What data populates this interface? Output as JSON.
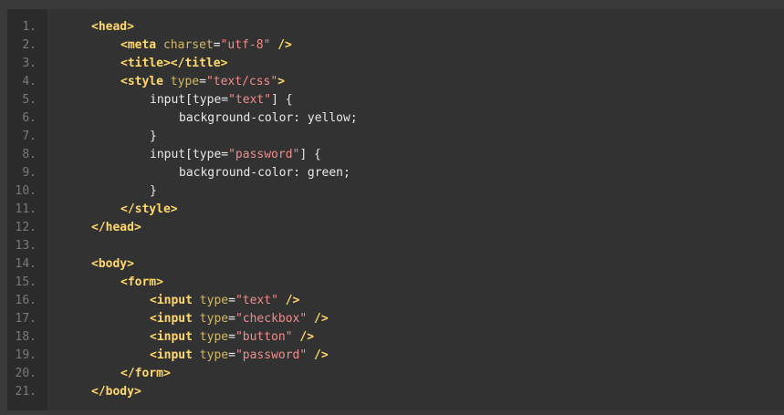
{
  "lines": [
    {
      "n": "1.",
      "indent": 1,
      "tokens": [
        {
          "c": "t",
          "v": "<head>"
        }
      ]
    },
    {
      "n": "2.",
      "indent": 2,
      "tokens": [
        {
          "c": "t",
          "v": "<meta "
        },
        {
          "c": "a",
          "v": "charset"
        },
        {
          "c": "p",
          "v": "="
        },
        {
          "c": "s",
          "v": "\"utf-8\""
        },
        {
          "c": "t",
          "v": " />"
        }
      ]
    },
    {
      "n": "3.",
      "indent": 2,
      "tokens": [
        {
          "c": "t",
          "v": "<title></title>"
        }
      ]
    },
    {
      "n": "4.",
      "indent": 2,
      "tokens": [
        {
          "c": "t",
          "v": "<style "
        },
        {
          "c": "a",
          "v": "type"
        },
        {
          "c": "p",
          "v": "="
        },
        {
          "c": "s",
          "v": "\"text/css\""
        },
        {
          "c": "t",
          "v": ">"
        }
      ]
    },
    {
      "n": "5.",
      "indent": 3,
      "tokens": [
        {
          "c": "p",
          "v": "input[type="
        },
        {
          "c": "s",
          "v": "\"text\""
        },
        {
          "c": "p",
          "v": "] {"
        }
      ]
    },
    {
      "n": "6.",
      "indent": 4,
      "tokens": [
        {
          "c": "p",
          "v": "background-color: yellow;"
        }
      ]
    },
    {
      "n": "7.",
      "indent": 3,
      "tokens": [
        {
          "c": "p",
          "v": "}"
        }
      ]
    },
    {
      "n": "8.",
      "indent": 3,
      "tokens": [
        {
          "c": "p",
          "v": "input[type="
        },
        {
          "c": "s",
          "v": "\"password\""
        },
        {
          "c": "p",
          "v": "] {"
        }
      ]
    },
    {
      "n": "9.",
      "indent": 4,
      "tokens": [
        {
          "c": "p",
          "v": "background-color: green;"
        }
      ]
    },
    {
      "n": "10.",
      "indent": 3,
      "tokens": [
        {
          "c": "p",
          "v": "}"
        }
      ]
    },
    {
      "n": "11.",
      "indent": 2,
      "tokens": [
        {
          "c": "t",
          "v": "</style>"
        }
      ]
    },
    {
      "n": "12.",
      "indent": 1,
      "tokens": [
        {
          "c": "t",
          "v": "</head>"
        }
      ]
    },
    {
      "n": "13.",
      "indent": 0,
      "tokens": []
    },
    {
      "n": "14.",
      "indent": 1,
      "tokens": [
        {
          "c": "t",
          "v": "<body>"
        }
      ]
    },
    {
      "n": "15.",
      "indent": 2,
      "tokens": [
        {
          "c": "t",
          "v": "<form>"
        }
      ]
    },
    {
      "n": "16.",
      "indent": 3,
      "tokens": [
        {
          "c": "t",
          "v": "<input "
        },
        {
          "c": "a",
          "v": "type"
        },
        {
          "c": "p",
          "v": "="
        },
        {
          "c": "s",
          "v": "\"text\""
        },
        {
          "c": "t",
          "v": " />"
        }
      ]
    },
    {
      "n": "17.",
      "indent": 3,
      "tokens": [
        {
          "c": "t",
          "v": "<input "
        },
        {
          "c": "a",
          "v": "type"
        },
        {
          "c": "p",
          "v": "="
        },
        {
          "c": "s",
          "v": "\"checkbox\""
        },
        {
          "c": "t",
          "v": " />"
        }
      ]
    },
    {
      "n": "18.",
      "indent": 3,
      "tokens": [
        {
          "c": "t",
          "v": "<input "
        },
        {
          "c": "a",
          "v": "type"
        },
        {
          "c": "p",
          "v": "="
        },
        {
          "c": "s",
          "v": "\"button\""
        },
        {
          "c": "t",
          "v": " />"
        }
      ]
    },
    {
      "n": "19.",
      "indent": 3,
      "tokens": [
        {
          "c": "t",
          "v": "<input "
        },
        {
          "c": "a",
          "v": "type"
        },
        {
          "c": "p",
          "v": "="
        },
        {
          "c": "s",
          "v": "\"password\""
        },
        {
          "c": "t",
          "v": " />"
        }
      ]
    },
    {
      "n": "20.",
      "indent": 2,
      "tokens": [
        {
          "c": "t",
          "v": "</form>"
        }
      ]
    },
    {
      "n": "21.",
      "indent": 1,
      "tokens": [
        {
          "c": "t",
          "v": "</body>"
        }
      ]
    }
  ]
}
